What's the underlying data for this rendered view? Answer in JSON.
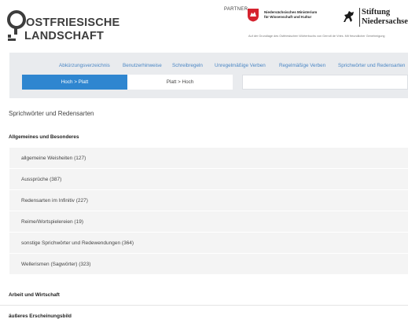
{
  "header": {
    "logo_line1": "OSTFRIESISCHE",
    "logo_line2": "LANDSCHAFT",
    "partner_label": "PARTNER",
    "ministry_line1": "Niedersächsisches Ministerium",
    "ministry_line2": "für Wissenschaft und Kultur",
    "stiftung_line1": "Stiftung",
    "stiftung_line2": "Niedersachsen",
    "funding_note": "Auf der Grundlage des Ostfriesischen Wörterbuchs von Gerrolt de Vries. Mit freundlicher Genehmigung"
  },
  "nav": {
    "links": [
      "Abkürzungsverzeichnis",
      "Benutzerhinweise",
      "Schreibregeln",
      "Unregelmäßige Verben",
      "Regelmäßige Verben",
      "Sprichwörter und Redensarten"
    ],
    "tab_active": "Hoch > Platt",
    "tab_inactive": "Platt > Hoch",
    "search_value": ""
  },
  "content": {
    "page_title": "Sprichwörter und Redensarten",
    "section1_heading": "Allgemeines und Besonderes",
    "section1_items": [
      "allgemeine Weisheiten (127)",
      "Aussprüche (387)",
      "Redensarten im Infinitiv (227)",
      "Reime/Wortspielereien (19)",
      "sonstige Sprichwörter und Redewendungen (364)",
      "Wellerismen (Sagwörter) (323)"
    ],
    "section2_heading": "Arbeit und Wirtschaft",
    "section3_heading": "äußeres Erscheinungsbild"
  },
  "colors": {
    "accent": "#2f86d0",
    "link": "#4a86c4",
    "nav_bg": "#e9ebee",
    "list_bg": "#f4f4f4"
  }
}
